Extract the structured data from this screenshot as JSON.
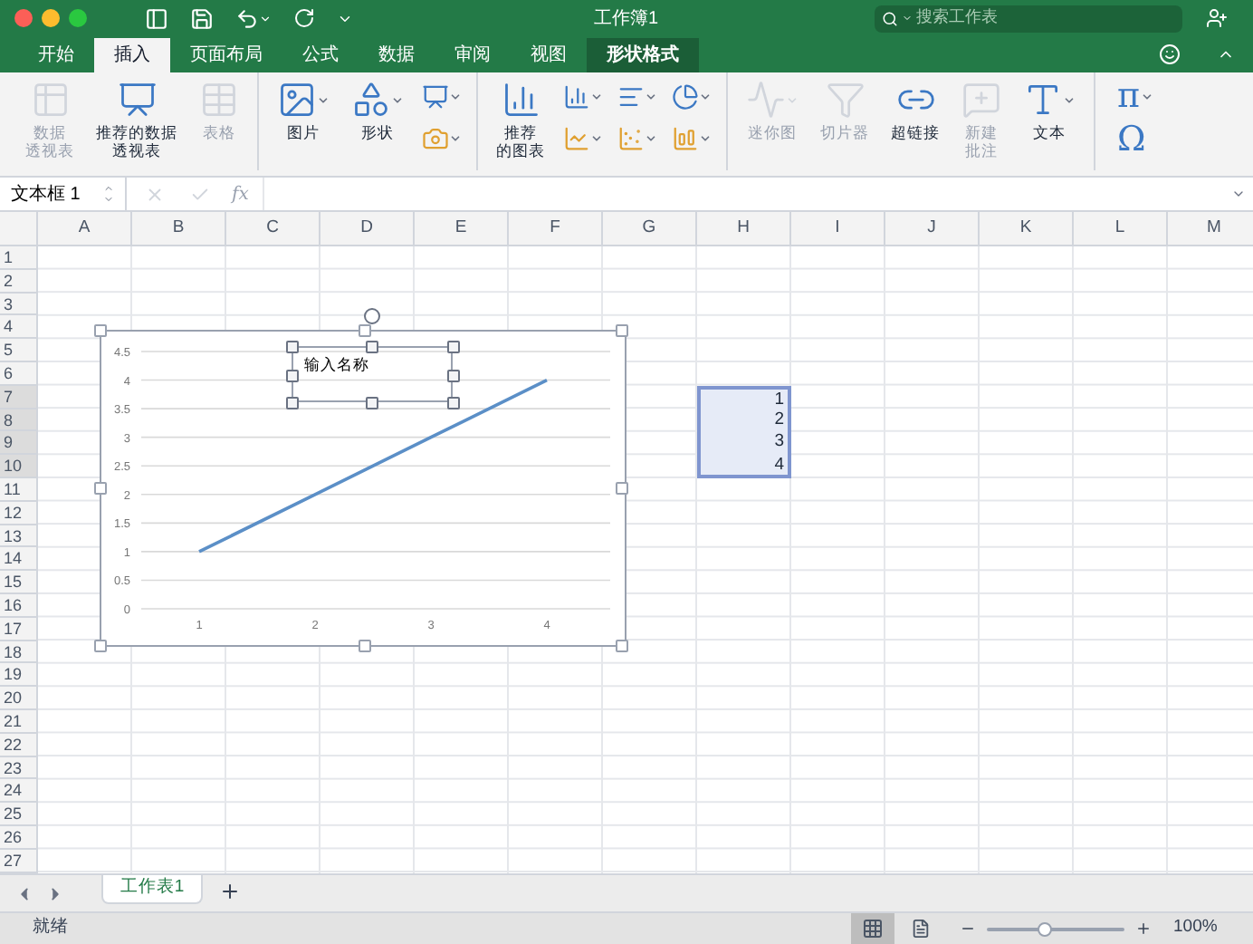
{
  "window": {
    "title": "工作簿1",
    "search": {
      "placeholder": "搜索工作表"
    }
  },
  "tabs": [
    {
      "label": "开始",
      "selected": false,
      "contextual": false
    },
    {
      "label": "插入",
      "selected": true,
      "contextual": false
    },
    {
      "label": "页面布局",
      "selected": false,
      "contextual": false
    },
    {
      "label": "公式",
      "selected": false,
      "contextual": false
    },
    {
      "label": "数据",
      "selected": false,
      "contextual": false
    },
    {
      "label": "审阅",
      "selected": false,
      "contextual": false
    },
    {
      "label": "视图",
      "selected": false,
      "contextual": false
    },
    {
      "label": "形状格式",
      "selected": false,
      "contextual": true
    }
  ],
  "ribbon": {
    "groups": [
      {
        "items": [
          {
            "kind": "large",
            "label": [
              "数据",
              "透视表"
            ],
            "disabled": true,
            "dropdown": false
          },
          {
            "kind": "large",
            "label": [
              "推荐的数据",
              "透视表"
            ],
            "disabled": false,
            "dropdown": false
          },
          {
            "kind": "large",
            "label": [
              "表格"
            ],
            "disabled": true,
            "dropdown": false
          }
        ]
      },
      {
        "items": [
          {
            "kind": "large",
            "label": [
              "图片"
            ],
            "disabled": false,
            "dropdown": true
          },
          {
            "kind": "large",
            "label": [
              "形状"
            ],
            "disabled": false,
            "dropdown": true
          },
          {
            "kind": "icons",
            "disabled": false,
            "dropdown": true
          }
        ]
      },
      {
        "items": [
          {
            "kind": "large",
            "label": [
              "推荐",
              "的图表"
            ],
            "disabled": false,
            "dropdown": false
          },
          {
            "kind": "icons",
            "disabled": false,
            "dropdown": true
          },
          {
            "kind": "icons",
            "disabled": false,
            "dropdown": true
          },
          {
            "kind": "icons",
            "disabled": false,
            "dropdown": true
          }
        ]
      },
      {
        "items": [
          {
            "kind": "large",
            "label": [
              "迷你图"
            ],
            "disabled": true,
            "dropdown": true
          },
          {
            "kind": "large",
            "label": [
              "切片器"
            ],
            "disabled": true,
            "dropdown": false
          },
          {
            "kind": "large",
            "label": [
              "超链接"
            ],
            "disabled": false,
            "dropdown": false
          },
          {
            "kind": "large",
            "label": [
              "新建",
              "批注"
            ],
            "disabled": true,
            "dropdown": false
          },
          {
            "kind": "large",
            "label": [
              "文本"
            ],
            "disabled": false,
            "dropdown": true
          }
        ]
      },
      {
        "items": [
          {
            "kind": "glyphs",
            "symbols": [
              "π",
              "Ω"
            ],
            "disabled": false,
            "dropdown": true
          }
        ]
      }
    ]
  },
  "formula_bar": {
    "name_box": "文本框 1",
    "function_label": "fx"
  },
  "sheet": {
    "columns": [
      "A",
      "B",
      "C",
      "D",
      "E",
      "F",
      "G",
      "H",
      "I",
      "J",
      "K",
      "L",
      "M"
    ],
    "rows": [
      {
        "number": "1",
        "selected": false
      },
      {
        "number": "2",
        "selected": false
      },
      {
        "number": "3",
        "selected": false
      },
      {
        "number": "4",
        "selected": false
      },
      {
        "number": "5",
        "selected": false
      },
      {
        "number": "6",
        "selected": false
      },
      {
        "number": "7",
        "h_value": "1",
        "selected": true
      },
      {
        "number": "8",
        "h_value": "2",
        "selected": true
      },
      {
        "number": "9",
        "h_value": "3",
        "selected": true
      },
      {
        "number": "10",
        "h_value": "4",
        "selected": true
      },
      {
        "number": "11",
        "selected": false
      },
      {
        "number": "12",
        "selected": false
      },
      {
        "number": "13",
        "selected": false
      },
      {
        "number": "14",
        "selected": false
      },
      {
        "number": "15",
        "selected": false
      },
      {
        "number": "16",
        "selected": false
      },
      {
        "number": "17",
        "selected": false
      },
      {
        "number": "18",
        "selected": false
      },
      {
        "number": "19",
        "selected": false
      },
      {
        "number": "20",
        "selected": false
      },
      {
        "number": "21",
        "selected": false
      },
      {
        "number": "22",
        "selected": false
      },
      {
        "number": "23",
        "selected": false
      },
      {
        "number": "24",
        "selected": false
      },
      {
        "number": "25",
        "selected": false
      },
      {
        "number": "26",
        "selected": false
      },
      {
        "number": "27",
        "selected": false
      }
    ]
  },
  "chart": {
    "text_box": "输入名称",
    "chart_data": {
      "type": "line",
      "grid": true,
      "categories": [
        "1",
        "2",
        "3",
        "4"
      ],
      "series": [
        {
          "color": "#5b8fc7",
          "values": [
            1,
            2,
            3,
            4
          ]
        }
      ],
      "ylim": [
        0,
        4.5
      ],
      "yticks": [
        0,
        0.5,
        1,
        1.5,
        2,
        2.5,
        3,
        3.5,
        4,
        4.5
      ]
    }
  },
  "sheet_tabs": [
    {
      "label": "工作表1",
      "selected": true
    }
  ],
  "status_bar": {
    "status": "就绪",
    "zoom": {
      "level": 0.42,
      "reading": "100%"
    }
  }
}
